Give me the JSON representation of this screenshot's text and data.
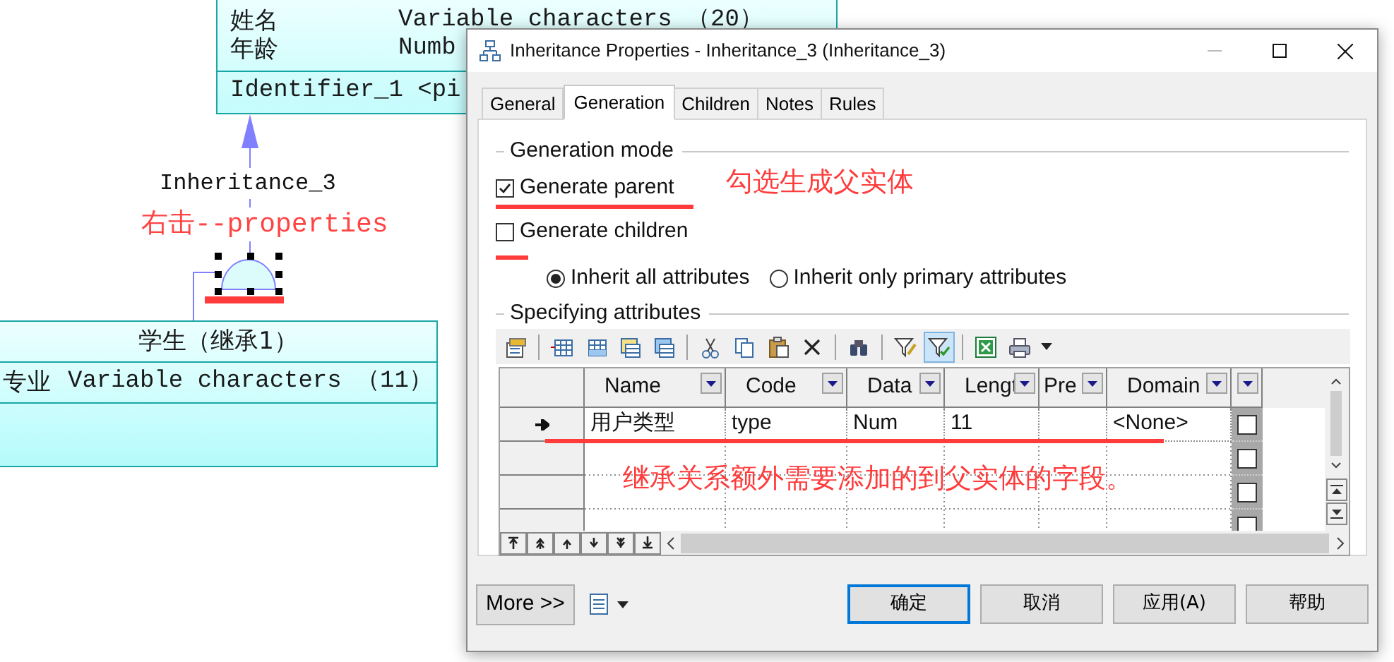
{
  "diagram": {
    "parent_entity": {
      "attributes": [
        {
          "name": "姓名",
          "type": "Variable characters （20）"
        },
        {
          "name": "年龄",
          "type": "Numb"
        }
      ],
      "identifier": "Identifier_1 <pi"
    },
    "inheritance_label": "Inheritance_3",
    "annotation": "右击--properties",
    "inheritance_selected": true,
    "child_entity": {
      "title": "学生（继承1）",
      "attributes": [
        {
          "name": "专业",
          "type": "Variable characters （11）"
        }
      ]
    }
  },
  "dialog": {
    "title": "Inheritance Properties - Inheritance_3 (Inheritance_3)",
    "tabs": [
      {
        "label": "General",
        "selected": false
      },
      {
        "label": "Generation",
        "selected": true
      },
      {
        "label": "Children",
        "selected": false
      },
      {
        "label": "Notes",
        "selected": false
      },
      {
        "label": "Rules",
        "selected": false
      }
    ],
    "generation_mode": {
      "legend": "Generation mode",
      "options": [
        {
          "label": "Generate parent",
          "checked": true
        },
        {
          "label": "Generate children",
          "checked": false
        }
      ],
      "inherit": [
        {
          "label": "Inherit all attributes",
          "selected": true
        },
        {
          "label": "Inherit only primary attributes",
          "selected": false
        }
      ]
    },
    "mode_annotation": "勾选生成父实体",
    "specifying": {
      "legend": "Specifying attributes",
      "toolbar": [
        {
          "kind": "properties",
          "pressed": false
        },
        {
          "kind": "insert-row",
          "pressed": false
        },
        {
          "kind": "add-row",
          "pressed": false
        },
        {
          "kind": "add-columns",
          "pressed": false
        },
        {
          "kind": "reuse-columns",
          "pressed": false
        },
        {
          "kind": "cut",
          "pressed": false
        },
        {
          "kind": "copy",
          "pressed": false
        },
        {
          "kind": "paste",
          "pressed": false
        },
        {
          "kind": "delete",
          "pressed": false
        },
        {
          "kind": "find",
          "pressed": false
        },
        {
          "kind": "filter-edit",
          "pressed": false
        },
        {
          "kind": "filter-check",
          "pressed": true
        },
        {
          "kind": "excel",
          "pressed": false
        },
        {
          "kind": "print",
          "pressed": false
        }
      ],
      "columns": [
        "Name",
        "Code",
        "Data",
        "Lengt",
        "Pre",
        "Domain"
      ],
      "rows": [
        {
          "current": true,
          "checked": false,
          "name": "用户类型",
          "code": "type",
          "data": "Num",
          "length": "11",
          "domain": "<None>"
        },
        {
          "current": false,
          "checked": false
        },
        {
          "current": false,
          "checked": false
        },
        {
          "current": false,
          "checked": false
        }
      ]
    },
    "grid_annotation": "继承关系额外需要添加的到父实体的字段。",
    "more_button": "More >>",
    "buttons": [
      {
        "label": "确定",
        "default": true
      },
      {
        "label": "取消",
        "default": false
      },
      {
        "label": "应用(A)",
        "default": false
      },
      {
        "label": "帮助",
        "default": false
      }
    ]
  }
}
